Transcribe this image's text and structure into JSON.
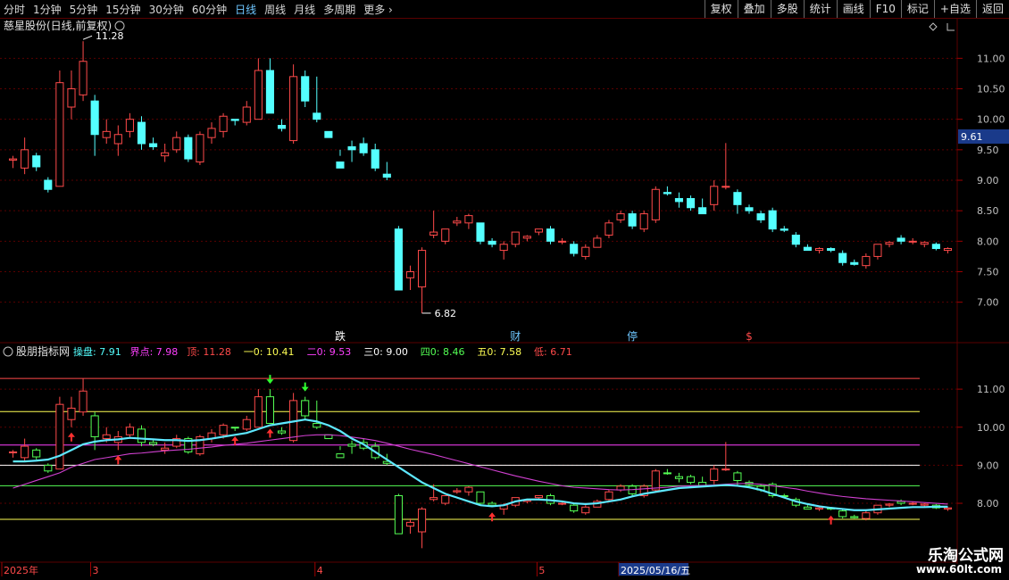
{
  "toolbar": {
    "periods": [
      "分时",
      "1分钟",
      "5分钟",
      "15分钟",
      "30分钟",
      "60分钟",
      "日线",
      "周线",
      "月线",
      "多周期",
      "更多"
    ],
    "active_period": "日线",
    "buttons": [
      "复权",
      "叠加",
      "多股",
      "统计",
      "画线",
      "F10",
      "标记",
      "+自选",
      "返回"
    ]
  },
  "colors": {
    "up": "#ff4a4a",
    "down": "#54ffff",
    "up_sub": "#ff4a4a",
    "down_sub": "#54ff54",
    "ma_cyan": "#5ee8ff",
    "ma_magenta": "#d040d0",
    "grid": "#5a0000",
    "axis": "#c0c0c0"
  },
  "main_panel": {
    "title": "慈星股份(日线,前复权)",
    "high_label": "11.28",
    "low_label": "6.82",
    "price_tag": "9.61",
    "markers": [
      {
        "text": "跌",
        "index": 28,
        "color": "#ffffff"
      },
      {
        "text": "财",
        "index": 43,
        "color": "#6ec6ff"
      },
      {
        "text": "停",
        "index": 53,
        "color": "#6ec6ff"
      },
      {
        "text": "$",
        "index": 63,
        "color": "#ff4a4a"
      }
    ]
  },
  "sub_panel": {
    "title": "股朋指标网",
    "labels": [
      {
        "name": "操盘",
        "value": "7.91",
        "color": "#54ffff"
      },
      {
        "name": "界点",
        "value": "7.98",
        "color": "#ff40ff"
      },
      {
        "name": "顶",
        "value": "11.28",
        "color": "#ff4a4a"
      },
      {
        "name": "一0",
        "value": "10.41",
        "color": "#ffff54"
      },
      {
        "name": "二0",
        "value": "9.53",
        "color": "#ff40ff"
      },
      {
        "name": "三0",
        "value": "9.00",
        "color": "#ffffff"
      },
      {
        "name": "四0",
        "value": "8.46",
        "color": "#54ff54"
      },
      {
        "name": "五0",
        "value": "7.58",
        "color": "#ffff54"
      },
      {
        "name": "低",
        "value": "6.71",
        "color": "#ff4a4a"
      }
    ],
    "levels": [
      {
        "value": 11.28,
        "color": "#ff4a4a"
      },
      {
        "value": 10.41,
        "color": "#ffff54"
      },
      {
        "value": 9.53,
        "color": "#ff40ff"
      },
      {
        "value": 9.0,
        "color": "#ffffff"
      },
      {
        "value": 8.46,
        "color": "#54ff54"
      },
      {
        "value": 7.58,
        "color": "#ffff54"
      }
    ]
  },
  "date_axis": [
    {
      "label": "2025年",
      "index": 0
    },
    {
      "label": "3",
      "index": 6.8
    },
    {
      "label": "4",
      "index": 26
    },
    {
      "label": "5",
      "index": 45
    },
    {
      "label": "2025/05/16/五",
      "index": 52,
      "highlight": true
    }
  ],
  "watermark": {
    "name": "乐淘公式网",
    "url": "www.60lt.com"
  },
  "chart_data": {
    "type": "candlestick",
    "main_ylim": [
      6.6,
      11.4
    ],
    "main_yticks": [
      7.0,
      7.5,
      8.0,
      8.5,
      9.0,
      9.5,
      10.0,
      10.5,
      11.0
    ],
    "sub_ylim": [
      6.5,
      11.8
    ],
    "sub_yticks": [
      8.0,
      9.0,
      10.0,
      11.0
    ],
    "candles": [
      {
        "o": 9.33,
        "h": 9.4,
        "l": 9.2,
        "c": 9.35
      },
      {
        "o": 9.2,
        "h": 9.7,
        "l": 9.1,
        "c": 9.5
      },
      {
        "o": 9.4,
        "h": 9.45,
        "l": 9.15,
        "c": 9.22
      },
      {
        "o": 9.0,
        "h": 9.05,
        "l": 8.8,
        "c": 8.85
      },
      {
        "o": 8.9,
        "h": 10.8,
        "l": 8.9,
        "c": 10.6
      },
      {
        "o": 10.2,
        "h": 10.8,
        "l": 10.0,
        "c": 10.5
      },
      {
        "o": 10.4,
        "h": 11.28,
        "l": 10.3,
        "c": 10.95
      },
      {
        "o": 10.3,
        "h": 10.4,
        "l": 9.4,
        "c": 9.75
      },
      {
        "o": 9.7,
        "h": 10.0,
        "l": 9.6,
        "c": 9.8
      },
      {
        "o": 9.6,
        "h": 9.9,
        "l": 9.4,
        "c": 9.75
      },
      {
        "o": 9.8,
        "h": 10.1,
        "l": 9.7,
        "c": 10.0
      },
      {
        "o": 9.95,
        "h": 10.05,
        "l": 9.5,
        "c": 9.6
      },
      {
        "o": 9.6,
        "h": 9.7,
        "l": 9.5,
        "c": 9.55
      },
      {
        "o": 9.4,
        "h": 9.6,
        "l": 9.3,
        "c": 9.45
      },
      {
        "o": 9.5,
        "h": 9.8,
        "l": 9.45,
        "c": 9.7
      },
      {
        "o": 9.7,
        "h": 9.75,
        "l": 9.3,
        "c": 9.35
      },
      {
        "o": 9.3,
        "h": 9.8,
        "l": 9.25,
        "c": 9.75
      },
      {
        "o": 9.7,
        "h": 9.95,
        "l": 9.6,
        "c": 9.85
      },
      {
        "o": 9.8,
        "h": 10.1,
        "l": 9.7,
        "c": 10.05
      },
      {
        "o": 10.0,
        "h": 10.0,
        "l": 9.9,
        "c": 9.98
      },
      {
        "o": 9.95,
        "h": 10.3,
        "l": 9.9,
        "c": 10.2
      },
      {
        "o": 10.0,
        "h": 11.0,
        "l": 10.0,
        "c": 10.8
      },
      {
        "o": 10.8,
        "h": 11.0,
        "l": 10.1,
        "c": 10.1
      },
      {
        "o": 9.9,
        "h": 10.0,
        "l": 9.8,
        "c": 9.85
      },
      {
        "o": 9.65,
        "h": 10.9,
        "l": 9.6,
        "c": 10.7
      },
      {
        "o": 10.7,
        "h": 10.8,
        "l": 10.2,
        "c": 10.3
      },
      {
        "o": 10.1,
        "h": 10.7,
        "l": 9.95,
        "c": 10.0
      },
      {
        "o": 9.8,
        "h": 9.8,
        "l": 9.7,
        "c": 9.7
      },
      {
        "o": 9.3,
        "h": 9.4,
        "l": 9.5,
        "c": 9.2
      },
      {
        "o": 9.55,
        "h": 9.65,
        "l": 9.3,
        "c": 9.5
      },
      {
        "o": 9.6,
        "h": 9.7,
        "l": 9.4,
        "c": 9.45
      },
      {
        "o": 9.5,
        "h": 9.6,
        "l": 9.15,
        "c": 9.2
      },
      {
        "o": 9.1,
        "h": 9.3,
        "l": 9.0,
        "c": 9.05
      },
      {
        "o": 8.2,
        "h": 8.25,
        "l": 7.2,
        "c": 7.2
      },
      {
        "o": 7.4,
        "h": 7.6,
        "l": 7.2,
        "c": 7.5
      },
      {
        "o": 7.25,
        "h": 7.9,
        "l": 6.82,
        "c": 7.85
      },
      {
        "o": 8.1,
        "h": 8.5,
        "l": 8.05,
        "c": 8.15
      },
      {
        "o": 8.0,
        "h": 8.2,
        "l": 7.95,
        "c": 8.2
      },
      {
        "o": 8.3,
        "h": 8.4,
        "l": 8.25,
        "c": 8.33
      },
      {
        "o": 8.3,
        "h": 8.45,
        "l": 8.2,
        "c": 8.42
      },
      {
        "o": 8.3,
        "h": 8.3,
        "l": 7.95,
        "c": 8.0
      },
      {
        "o": 8.0,
        "h": 8.05,
        "l": 7.9,
        "c": 7.95
      },
      {
        "o": 7.85,
        "h": 8.0,
        "l": 7.7,
        "c": 7.95
      },
      {
        "o": 7.95,
        "h": 8.15,
        "l": 7.9,
        "c": 8.15
      },
      {
        "o": 8.05,
        "h": 8.1,
        "l": 8.0,
        "c": 8.08
      },
      {
        "o": 8.15,
        "h": 8.2,
        "l": 8.1,
        "c": 8.2
      },
      {
        "o": 8.2,
        "h": 8.25,
        "l": 7.95,
        "c": 8.0
      },
      {
        "o": 8.0,
        "h": 8.05,
        "l": 7.95,
        "c": 8.0
      },
      {
        "o": 7.95,
        "h": 8.0,
        "l": 7.75,
        "c": 7.8
      },
      {
        "o": 7.75,
        "h": 7.95,
        "l": 7.7,
        "c": 7.9
      },
      {
        "o": 7.9,
        "h": 8.1,
        "l": 7.9,
        "c": 8.05
      },
      {
        "o": 8.1,
        "h": 8.35,
        "l": 8.05,
        "c": 8.3
      },
      {
        "o": 8.35,
        "h": 8.5,
        "l": 8.3,
        "c": 8.45
      },
      {
        "o": 8.45,
        "h": 8.5,
        "l": 8.2,
        "c": 8.25
      },
      {
        "o": 8.2,
        "h": 8.5,
        "l": 8.15,
        "c": 8.45
      },
      {
        "o": 8.35,
        "h": 8.9,
        "l": 8.3,
        "c": 8.85
      },
      {
        "o": 8.8,
        "h": 8.9,
        "l": 8.75,
        "c": 8.78
      },
      {
        "o": 8.7,
        "h": 8.8,
        "l": 8.55,
        "c": 8.65
      },
      {
        "o": 8.7,
        "h": 8.75,
        "l": 8.5,
        "c": 8.55
      },
      {
        "o": 8.55,
        "h": 8.7,
        "l": 8.45,
        "c": 8.45
      },
      {
        "o": 8.6,
        "h": 9.0,
        "l": 8.5,
        "c": 8.9
      },
      {
        "o": 8.9,
        "h": 9.61,
        "l": 8.85,
        "c": 8.9
      },
      {
        "o": 8.8,
        "h": 8.85,
        "l": 8.45,
        "c": 8.6
      },
      {
        "o": 8.55,
        "h": 8.6,
        "l": 8.45,
        "c": 8.5
      },
      {
        "o": 8.45,
        "h": 8.5,
        "l": 8.3,
        "c": 8.35
      },
      {
        "o": 8.5,
        "h": 8.55,
        "l": 8.15,
        "c": 8.2
      },
      {
        "o": 8.2,
        "h": 8.25,
        "l": 8.15,
        "c": 8.18
      },
      {
        "o": 8.1,
        "h": 8.15,
        "l": 7.9,
        "c": 7.95
      },
      {
        "o": 7.9,
        "h": 7.95,
        "l": 7.85,
        "c": 7.85
      },
      {
        "o": 7.85,
        "h": 7.9,
        "l": 7.8,
        "c": 7.88
      },
      {
        "o": 7.88,
        "h": 7.9,
        "l": 7.82,
        "c": 7.85
      },
      {
        "o": 7.8,
        "h": 7.85,
        "l": 7.6,
        "c": 7.65
      },
      {
        "o": 7.65,
        "h": 7.7,
        "l": 7.6,
        "c": 7.62
      },
      {
        "o": 7.6,
        "h": 7.8,
        "l": 7.55,
        "c": 7.75
      },
      {
        "o": 7.75,
        "h": 7.95,
        "l": 7.7,
        "c": 7.95
      },
      {
        "o": 7.95,
        "h": 8.0,
        "l": 7.9,
        "c": 7.98
      },
      {
        "o": 8.05,
        "h": 8.1,
        "l": 7.95,
        "c": 8.0
      },
      {
        "o": 8.0,
        "h": 8.05,
        "l": 7.95,
        "c": 8.0
      },
      {
        "o": 7.95,
        "h": 8.0,
        "l": 7.9,
        "c": 7.98
      },
      {
        "o": 7.95,
        "h": 7.98,
        "l": 7.85,
        "c": 7.88
      },
      {
        "o": 7.85,
        "h": 7.9,
        "l": 7.8,
        "c": 7.88
      }
    ],
    "cyan_line": [
      9.1,
      9.1,
      9.12,
      9.15,
      9.25,
      9.4,
      9.55,
      9.62,
      9.66,
      9.68,
      9.72,
      9.7,
      9.68,
      9.66,
      9.66,
      9.64,
      9.66,
      9.7,
      9.75,
      9.8,
      9.85,
      9.95,
      10.05,
      10.1,
      10.15,
      10.2,
      10.15,
      10.05,
      9.9,
      9.7,
      9.55,
      9.35,
      9.15,
      8.95,
      8.75,
      8.55,
      8.4,
      8.25,
      8.15,
      8.05,
      7.95,
      7.92,
      7.95,
      8.05,
      8.1,
      8.1,
      8.08,
      8.05,
      8.0,
      7.98,
      8.0,
      8.05,
      8.1,
      8.18,
      8.25,
      8.3,
      8.35,
      8.4,
      8.42,
      8.44,
      8.46,
      8.48,
      8.46,
      8.42,
      8.35,
      8.25,
      8.15,
      8.05,
      7.98,
      7.92,
      7.88,
      7.85,
      7.82,
      7.82,
      7.84,
      7.86,
      7.88,
      7.9,
      7.9,
      7.91,
      7.91
    ],
    "magenta_line": [
      8.4,
      8.5,
      8.6,
      8.7,
      8.8,
      8.95,
      9.05,
      9.15,
      9.2,
      9.25,
      9.3,
      9.32,
      9.35,
      9.38,
      9.4,
      9.42,
      9.45,
      9.48,
      9.52,
      9.55,
      9.58,
      9.62,
      9.66,
      9.7,
      9.74,
      9.78,
      9.8,
      9.8,
      9.78,
      9.74,
      9.7,
      9.65,
      9.58,
      9.5,
      9.42,
      9.35,
      9.28,
      9.2,
      9.12,
      9.04,
      8.96,
      8.88,
      8.8,
      8.72,
      8.65,
      8.58,
      8.52,
      8.46,
      8.42,
      8.4,
      8.38,
      8.36,
      8.35,
      8.36,
      8.38,
      8.4,
      8.42,
      8.45,
      8.46,
      8.47,
      8.48,
      8.5,
      8.52,
      8.52,
      8.5,
      8.46,
      8.42,
      8.38,
      8.32,
      8.27,
      8.22,
      8.18,
      8.15,
      8.12,
      8.1,
      8.08,
      8.06,
      8.04,
      8.02,
      8.0,
      7.98
    ],
    "up_arrows": [
      5,
      9,
      19,
      22,
      41,
      70
    ],
    "down_arrows": [
      22,
      25
    ]
  }
}
